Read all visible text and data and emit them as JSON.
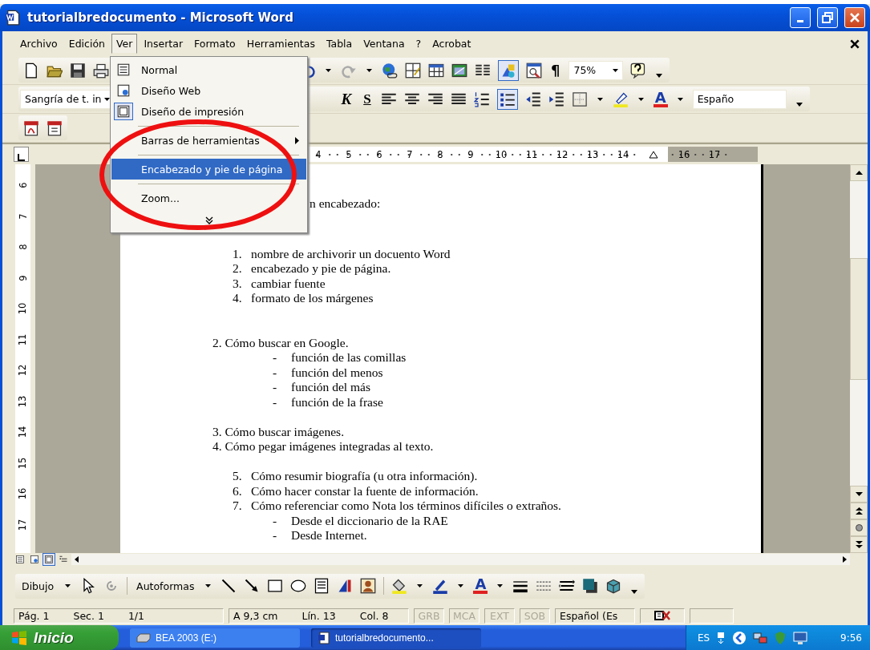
{
  "window": {
    "title": "tutorialbredocumento - Microsoft Word"
  },
  "menu_bar": [
    {
      "label": "Archivo",
      "selected": false
    },
    {
      "label": "Edición",
      "selected": false
    },
    {
      "label": "Ver",
      "selected": true
    },
    {
      "label": "Insertar",
      "selected": false
    },
    {
      "label": "Formato",
      "selected": false
    },
    {
      "label": "Herramientas",
      "selected": false
    },
    {
      "label": "Tabla",
      "selected": false
    },
    {
      "label": "Ventana",
      "selected": false
    },
    {
      "label": "?",
      "selected": false
    },
    {
      "label": "Acrobat",
      "selected": false
    }
  ],
  "view_menu": [
    {
      "kind": "view",
      "label": "Normal",
      "checked": false,
      "selected": false
    },
    {
      "kind": "view",
      "label": "Diseño Web",
      "checked": false,
      "selected": false
    },
    {
      "kind": "view",
      "label": "Diseño de impresión",
      "checked": true,
      "selected": false
    },
    {
      "kind": "separator"
    },
    {
      "kind": "submenu",
      "label": "Barras de herramientas",
      "selected": false
    },
    {
      "kind": "separator"
    },
    {
      "kind": "item",
      "label": "Encabezado y pie de página",
      "selected": true
    },
    {
      "kind": "separator"
    },
    {
      "kind": "item",
      "label": "Zoom...",
      "selected": false
    }
  ],
  "standard_toolbar": {
    "pilcrow": "¶",
    "zoom": "75%",
    "drawing_on": true
  },
  "formatting_toolbar": {
    "style": "Sangría de t. in",
    "italic": "K",
    "underline": "S",
    "font_color": "A",
    "language": "Españo",
    "bullets_on": true
  },
  "ruler": {
    "h_numbers": [
      "4",
      "5",
      "6",
      "7",
      "8",
      "9",
      "10",
      "11",
      "12",
      "13",
      "14",
      "16",
      "17"
    ],
    "v_numbers": [
      "6",
      "7",
      "8",
      "9",
      "10",
      "11",
      "12",
      "13",
      "14",
      "15",
      "16",
      "17"
    ]
  },
  "document": {
    "fragment": "n encabezado:",
    "lines": [
      {
        "kind": "numbered",
        "number": "1.",
        "text": "nombre de archivorir un docuento Word"
      },
      {
        "kind": "numbered",
        "number": "2.",
        "text": "encabezado y pie de página."
      },
      {
        "kind": "numbered",
        "number": "3.",
        "text": "cambiar fuente"
      },
      {
        "kind": "numbered",
        "number": "4.",
        "text": "formato de los márgenes"
      },
      {
        "kind": "blank"
      },
      {
        "kind": "blank"
      },
      {
        "kind": "heading",
        "text": "2. Cómo buscar en Google."
      },
      {
        "kind": "dash",
        "number": "-",
        "text": "función de las comillas"
      },
      {
        "kind": "dash",
        "number": "-",
        "text": "función del menos"
      },
      {
        "kind": "dash",
        "number": "-",
        "text": "función del más"
      },
      {
        "kind": "dash",
        "number": "-",
        "text": "función de la frase"
      },
      {
        "kind": "blank"
      },
      {
        "kind": "heading",
        "text": "3. Cómo buscar imágenes."
      },
      {
        "kind": "heading",
        "text": "4. Cómo pegar imágenes integradas al texto."
      },
      {
        "kind": "blank"
      },
      {
        "kind": "numbered",
        "number": "5.",
        "text": "Cómo resumir biografía (u otra información)."
      },
      {
        "kind": "numbered",
        "number": "6.",
        "text": "Cómo hacer constar la fuente de información."
      },
      {
        "kind": "numbered",
        "number": "7.",
        "text": "Cómo referenciar como Nota los términos difíciles o extraños."
      },
      {
        "kind": "dash",
        "number": "-",
        "text": "Desde el diccionario de la RAE"
      },
      {
        "kind": "dash",
        "number": "-",
        "text": "Desde Internet."
      }
    ]
  },
  "view_buttons": [
    {
      "selected": false
    },
    {
      "selected": false
    },
    {
      "selected": true
    },
    {
      "selected": false
    }
  ],
  "drawing_toolbar": {
    "draw_menu": "Dibujo",
    "autoshapes": "Autoformas",
    "font_color": "A"
  },
  "status_bar": [
    {
      "kind": "texts",
      "texts": [
        "Pág. 1",
        "Sec. 1",
        "1/1"
      ]
    },
    {
      "kind": "texts",
      "texts": [
        "A 9,3 cm",
        "Lín. 13",
        "Col. 8"
      ]
    },
    {
      "kind": "mode",
      "text": "GRB",
      "disabled": true
    },
    {
      "kind": "mode",
      "text": "MCA",
      "disabled": true
    },
    {
      "kind": "mode",
      "text": "EXT",
      "disabled": true
    },
    {
      "kind": "mode",
      "text": "SOB",
      "disabled": true
    },
    {
      "kind": "texts",
      "texts": [
        "Español (Es"
      ]
    },
    {
      "kind": "spelling"
    },
    {
      "kind": "empty"
    }
  ],
  "taskbar": {
    "start": "Inicio",
    "tasks": [
      {
        "label": "BEA 2003 (E:)",
        "selected": false
      },
      {
        "label": "tutorialbredocumento...",
        "selected": true
      }
    ],
    "language": "ES",
    "clock": "9:56"
  }
}
